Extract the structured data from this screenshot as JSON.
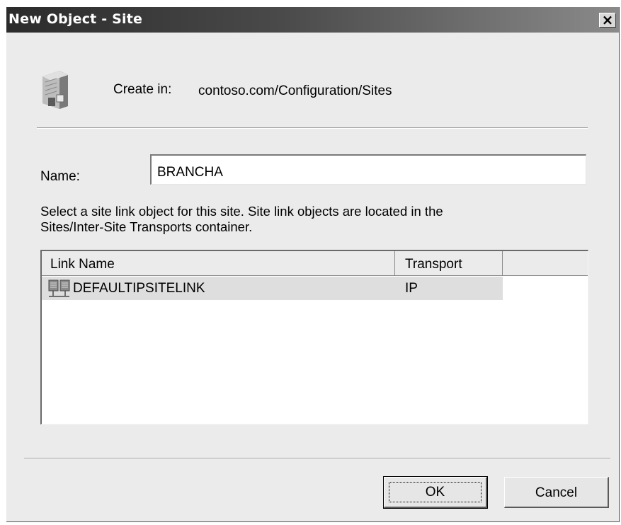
{
  "window": {
    "title": "New Object - Site",
    "close_glyph": "×"
  },
  "header": {
    "icon": "site-building-icon",
    "create_in_label": "Create in:",
    "create_in_path": "contoso.com/Configuration/Sites"
  },
  "name_field": {
    "label": "Name:",
    "value": "BRANCHA"
  },
  "instructions": {
    "line1": "Select a site link object for this site. Site link objects are located in the",
    "line2": "Sites/Inter-Site Transports container."
  },
  "site_links": {
    "columns": [
      "Link Name",
      "Transport"
    ],
    "rows": [
      {
        "icon": "site-link-icon",
        "name": "DEFAULTIPSITELINK",
        "transport": "IP",
        "selected": true
      }
    ]
  },
  "buttons": {
    "ok": "OK",
    "cancel": "Cancel"
  },
  "colors": {
    "dialog_bg": "#ebebeb",
    "titlebar_start": "#2b2b2b",
    "titlebar_end": "#8a8a8a",
    "selection_bg": "#dedede"
  }
}
